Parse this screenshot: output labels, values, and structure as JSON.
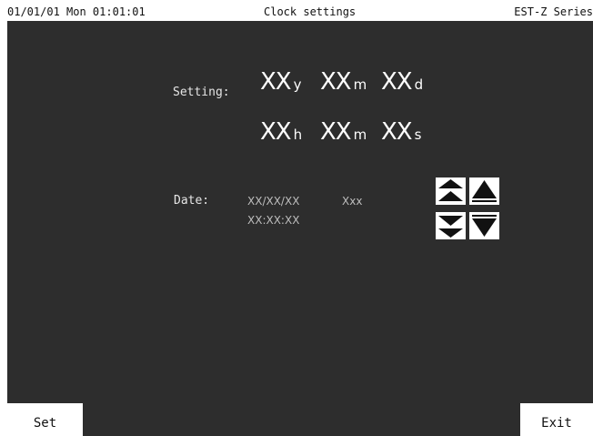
{
  "status_bar": {
    "datetime": "01/01/01 Mon  01:01:01",
    "title": "Clock settings",
    "series": "EST-Z Series"
  },
  "setting": {
    "label": "Setting:",
    "year": {
      "value": "XX",
      "unit": "y"
    },
    "month": {
      "value": "XX",
      "unit": "m"
    },
    "day": {
      "value": "XX",
      "unit": "d"
    },
    "hour": {
      "value": "XX",
      "unit": "h"
    },
    "minute": {
      "value": "XX",
      "unit": "m"
    },
    "second": {
      "value": "XX",
      "unit": "s"
    }
  },
  "current": {
    "label": "Date:",
    "date": "XX/XX/XX",
    "weekday": "Xxx",
    "time": "XX:XX:XX"
  },
  "controls": {
    "fast_up_icon": "double-up-arrow-icon",
    "up_icon": "up-arrow-icon",
    "fast_down_icon": "double-down-arrow-icon",
    "down_icon": "down-arrow-icon"
  },
  "softkeys": {
    "set": "Set",
    "exit": "Exit"
  }
}
